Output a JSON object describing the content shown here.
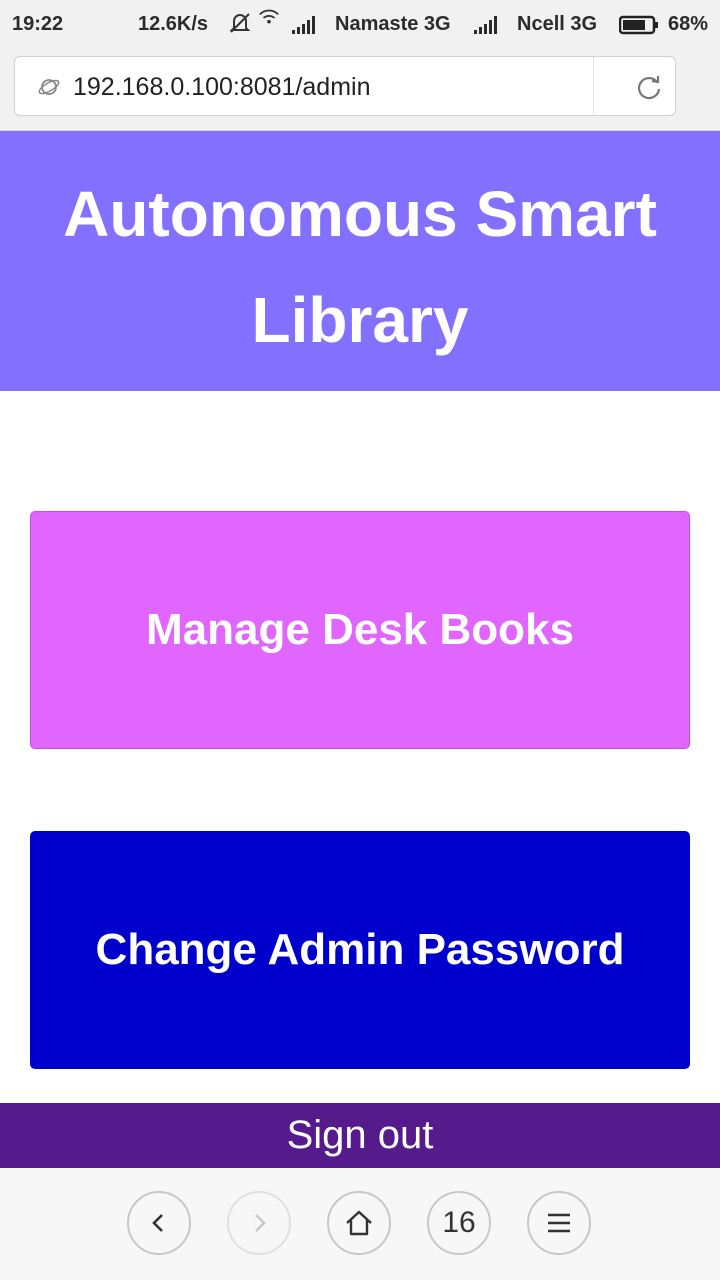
{
  "status_bar": {
    "time": "19:22",
    "speed": "12.6K/s",
    "network1": "Namaste 3G",
    "network2": "Ncell 3G",
    "battery": "68%"
  },
  "browser": {
    "url": "192.168.0.100:8081/admin",
    "tab_count": "16"
  },
  "page": {
    "title": "Autonomous Smart Library",
    "buttons": {
      "manage": "Manage Desk Books",
      "change_password": "Change Admin Password",
      "sign_out": "Sign out"
    }
  },
  "colors": {
    "header": "#8470ff",
    "manage_button": "#e066ff",
    "change_password_button": "#0000cd",
    "sign_out_bar": "#551a8b"
  },
  "icons": [
    "mute-bell-icon",
    "wifi-icon",
    "signal-icon",
    "battery-icon",
    "globe-icon",
    "reload-icon",
    "back-icon",
    "forward-icon",
    "home-icon",
    "menu-icon"
  ]
}
